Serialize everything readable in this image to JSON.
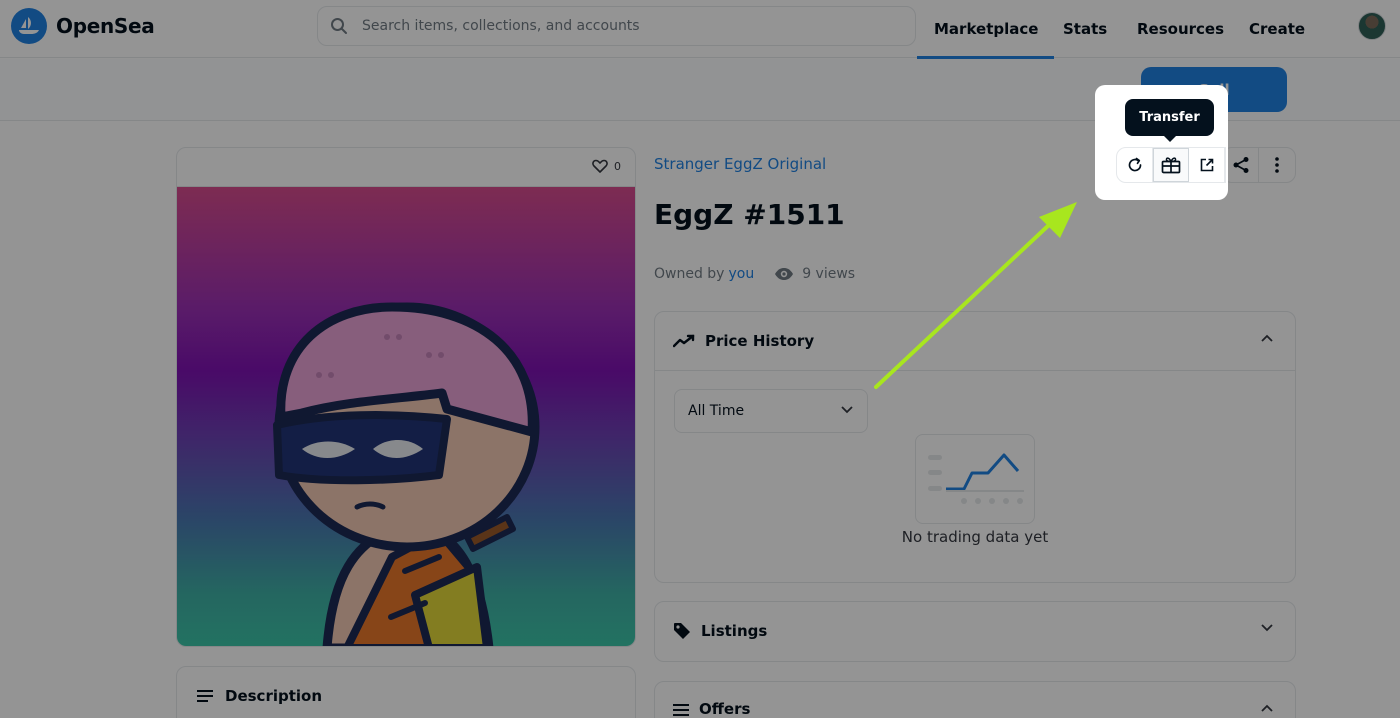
{
  "brand": {
    "name": "OpenSea",
    "accent": "#2081e2"
  },
  "search": {
    "placeholder": "Search items, collections, and accounts"
  },
  "nav": {
    "items": [
      {
        "label": "Marketplace"
      },
      {
        "label": "Stats"
      },
      {
        "label": "Resources"
      },
      {
        "label": "Create"
      }
    ]
  },
  "actions": {
    "sell_label": "Sell",
    "tooltip": "Transfer",
    "icons": [
      "refresh-icon",
      "transfer-icon",
      "external-link-icon",
      "share-icon",
      "more-options-icon"
    ]
  },
  "item": {
    "favorites": "0",
    "collection": "Stranger EggZ Original",
    "title": "EggZ #1511",
    "owned_by_label": "Owned by",
    "owner": "you",
    "views": "9 views"
  },
  "price_history": {
    "title": "Price History",
    "range": "All Time",
    "empty": "No trading data yet"
  },
  "panels": {
    "listings": "Listings",
    "offers": "Offers"
  },
  "description": {
    "title": "Description"
  },
  "annotation": {
    "arrow_color": "#a8e61e"
  }
}
